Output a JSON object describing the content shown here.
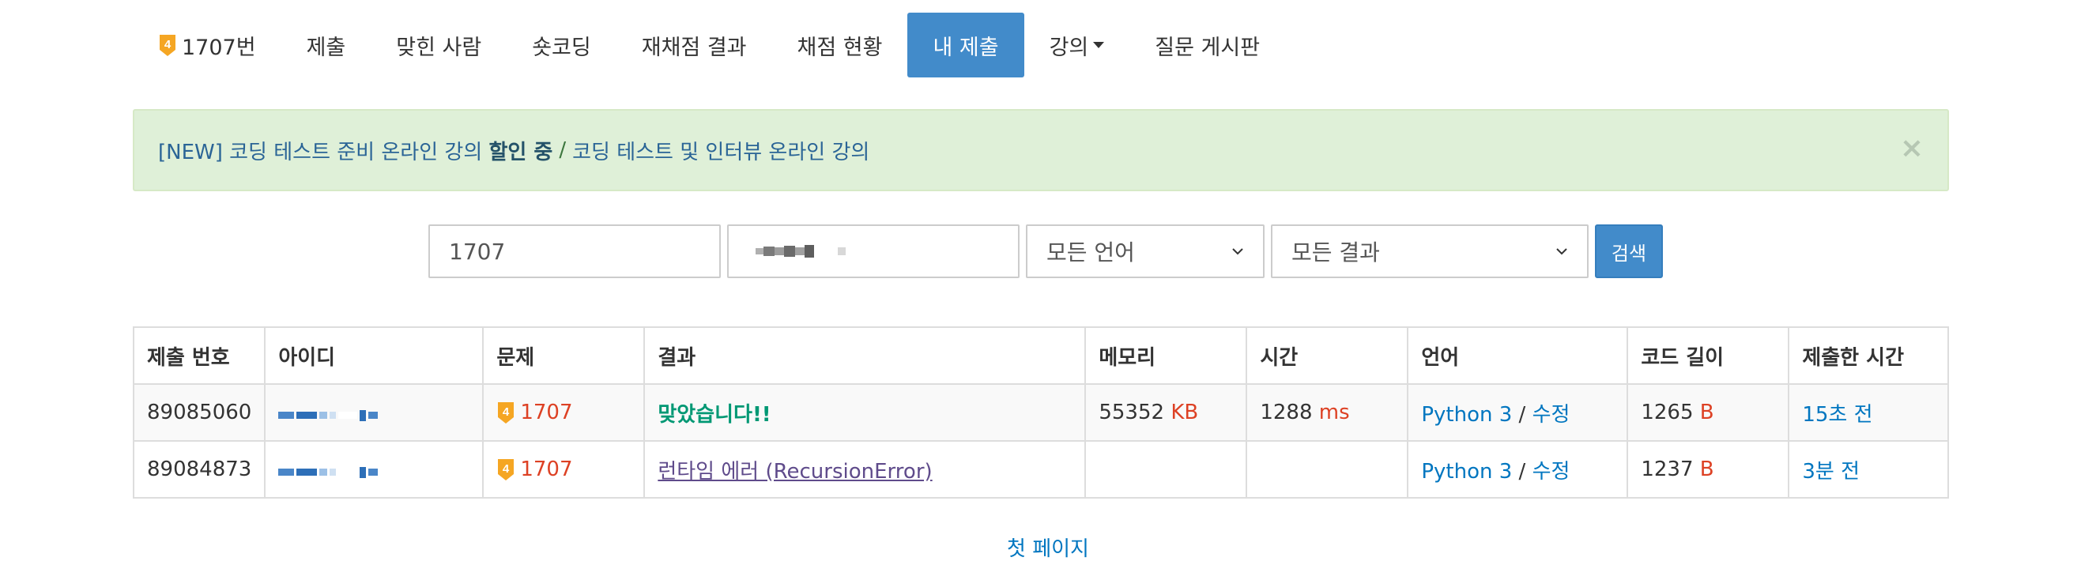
{
  "nav": {
    "problem_badge": "4",
    "items": [
      {
        "label": "1707번"
      },
      {
        "label": "제출"
      },
      {
        "label": "맞힌 사람"
      },
      {
        "label": "숏코딩"
      },
      {
        "label": "재채점 결과"
      },
      {
        "label": "채점 현황"
      },
      {
        "label": "내 제출"
      },
      {
        "label": "강의"
      },
      {
        "label": "질문 게시판"
      }
    ],
    "active_index": 6
  },
  "alert": {
    "prefix": "[NEW] 코딩 테스트 준비 온라인 강의 ",
    "bold": "할인 중",
    "separator": "/",
    "link2": "코딩 테스트 및 인터뷰 온라인 강의",
    "close": "×"
  },
  "search": {
    "problem_value": "1707",
    "language_selected": "모든 언어",
    "result_selected": "모든 결과",
    "button_label": "검색"
  },
  "table": {
    "headers": [
      "제출 번호",
      "아이디",
      "문제",
      "결과",
      "메모리",
      "시간",
      "언어",
      "코드 길이",
      "제출한 시간"
    ],
    "rows": [
      {
        "submission_id": "89085060",
        "problem": "1707",
        "result": "맞았습니다!!",
        "memory": "55352",
        "memory_unit": "KB",
        "time": "1288",
        "time_unit": "ms",
        "language": "Python 3",
        "lang_sep": "/",
        "edit": "수정",
        "code_length": "1265",
        "code_unit": "B",
        "submitted": "15초 전"
      },
      {
        "submission_id": "89084873",
        "problem": "1707",
        "result": "런타임 에러 (RecursionError)",
        "memory": "",
        "memory_unit": "",
        "time": "",
        "time_unit": "",
        "language": "Python 3",
        "lang_sep": "/",
        "edit": "수정",
        "code_length": "1237",
        "code_unit": "B",
        "submitted": "3분 전"
      }
    ]
  },
  "pagination": {
    "first_page": "첫 페이지"
  },
  "colors": {
    "primary": "#428bca",
    "accepted": "#009874",
    "runtime_error": "#5f4b8b",
    "link": "#0076c0",
    "unit_red": "#dd4124",
    "alert_bg": "#dff0d8",
    "badge_orange": "#f5a623"
  }
}
